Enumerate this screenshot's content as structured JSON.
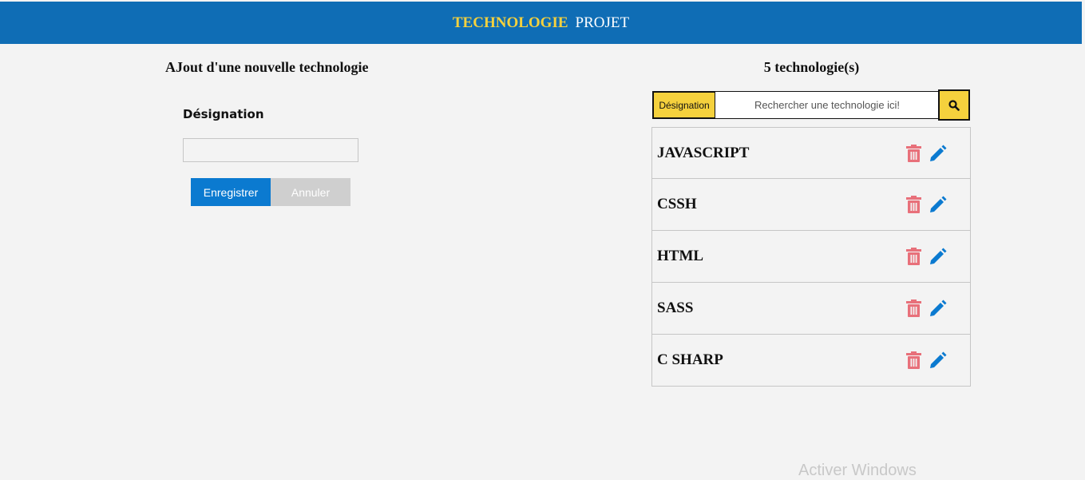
{
  "header": {
    "brand_accent": "TECHNOLOGIE",
    "brand_rest": "PROJET"
  },
  "form": {
    "title": "AJout d'une nouvelle technologie",
    "field_label": "Désignation",
    "field_value": "",
    "save_label": "Enregistrer",
    "cancel_label": "Annuler"
  },
  "list": {
    "count_title": "5 technologie(s)",
    "search_tag": "Désignation",
    "search_placeholder": "Rechercher une technologie ici!",
    "items": [
      {
        "label": "JAVASCRIPT"
      },
      {
        "label": "CSSH"
      },
      {
        "label": "HTML"
      },
      {
        "label": "SASS"
      },
      {
        "label": "C SHARP"
      }
    ]
  },
  "colors": {
    "header_bg": "#0f6db5",
    "accent_yellow": "#f5d13d",
    "primary_button": "#0b7ad0",
    "delete_icon": "#e8707a",
    "edit_icon": "#0b7ad0"
  },
  "watermark": "Activer Windows"
}
